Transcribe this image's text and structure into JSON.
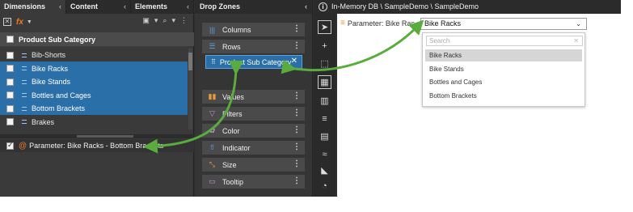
{
  "tabs": [
    {
      "label": "Dimensions"
    },
    {
      "label": "Content"
    },
    {
      "label": "Elements"
    }
  ],
  "toolbar": {
    "fx_label": "fx"
  },
  "group": {
    "label": "Product Sub Category"
  },
  "members": [
    {
      "label": "Bib-Shorts",
      "selected": false
    },
    {
      "label": "Bike Racks",
      "selected": true
    },
    {
      "label": "Bike Stands",
      "selected": true
    },
    {
      "label": "Bottles and Cages",
      "selected": true
    },
    {
      "label": "Bottom Brackets",
      "selected": true
    },
    {
      "label": "Brakes",
      "selected": false
    }
  ],
  "parameter_row": {
    "label": "Parameter: Bike Racks - Bottom Brackets"
  },
  "drop_zones": {
    "title": "Drop Zones",
    "zones": [
      {
        "label": "Columns"
      },
      {
        "label": "Rows"
      },
      {
        "label": "Values"
      },
      {
        "label": "Filters"
      },
      {
        "label": "Color"
      },
      {
        "label": "Indicator"
      },
      {
        "label": "Size"
      },
      {
        "label": "Tooltip"
      }
    ],
    "rows_chip": "Product Sub Category"
  },
  "canvas": {
    "breadcrumb": "In-Memory DB \\ SampleDemo \\ SampleDemo",
    "param_label": "Parameter: Bike Rac...",
    "select_value": "Bike Racks",
    "search_placeholder": "Search",
    "options": [
      {
        "label": "Bike Racks",
        "highlighted": true
      },
      {
        "label": "Bike Stands",
        "highlighted": false
      },
      {
        "label": "Bottles and Cages",
        "highlighted": false
      },
      {
        "label": "Bottom Brackets",
        "highlighted": false
      }
    ]
  },
  "colors": {
    "selection": "#2a6fa8",
    "arrow": "#5aac3e",
    "accent": "#f07b24"
  }
}
